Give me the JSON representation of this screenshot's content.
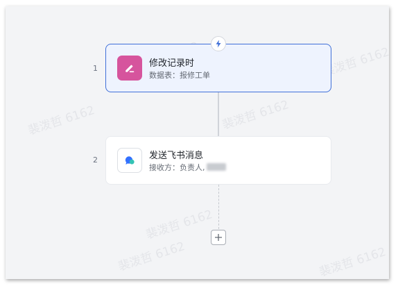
{
  "watermarks": [
    "裴泼哲 6162",
    "裴泼哲 6162",
    "裴泼哲 6162",
    "裴泼哲 6162",
    "裴泼哲 6162",
    "裴泼哲 6162",
    "裴泼哲 6162"
  ],
  "steps": [
    {
      "number": "1",
      "title": "修改记录时",
      "subtitle": "数据表：报修工单",
      "icon": "edit-pencil-icon",
      "icon_bg": "#d6549d"
    },
    {
      "number": "2",
      "title": "发送飞书消息",
      "subtitle": "接收方：负责人,",
      "icon": "feishu-message-icon",
      "icon_bg": "#ffffff"
    }
  ],
  "trigger_icon": "lightning-bolt-icon",
  "add_icon": "plus-icon",
  "colors": {
    "accent": "#3f6fd8",
    "active_card_bg": "#eef3fe",
    "canvas_bg": "#f3f4f6"
  }
}
